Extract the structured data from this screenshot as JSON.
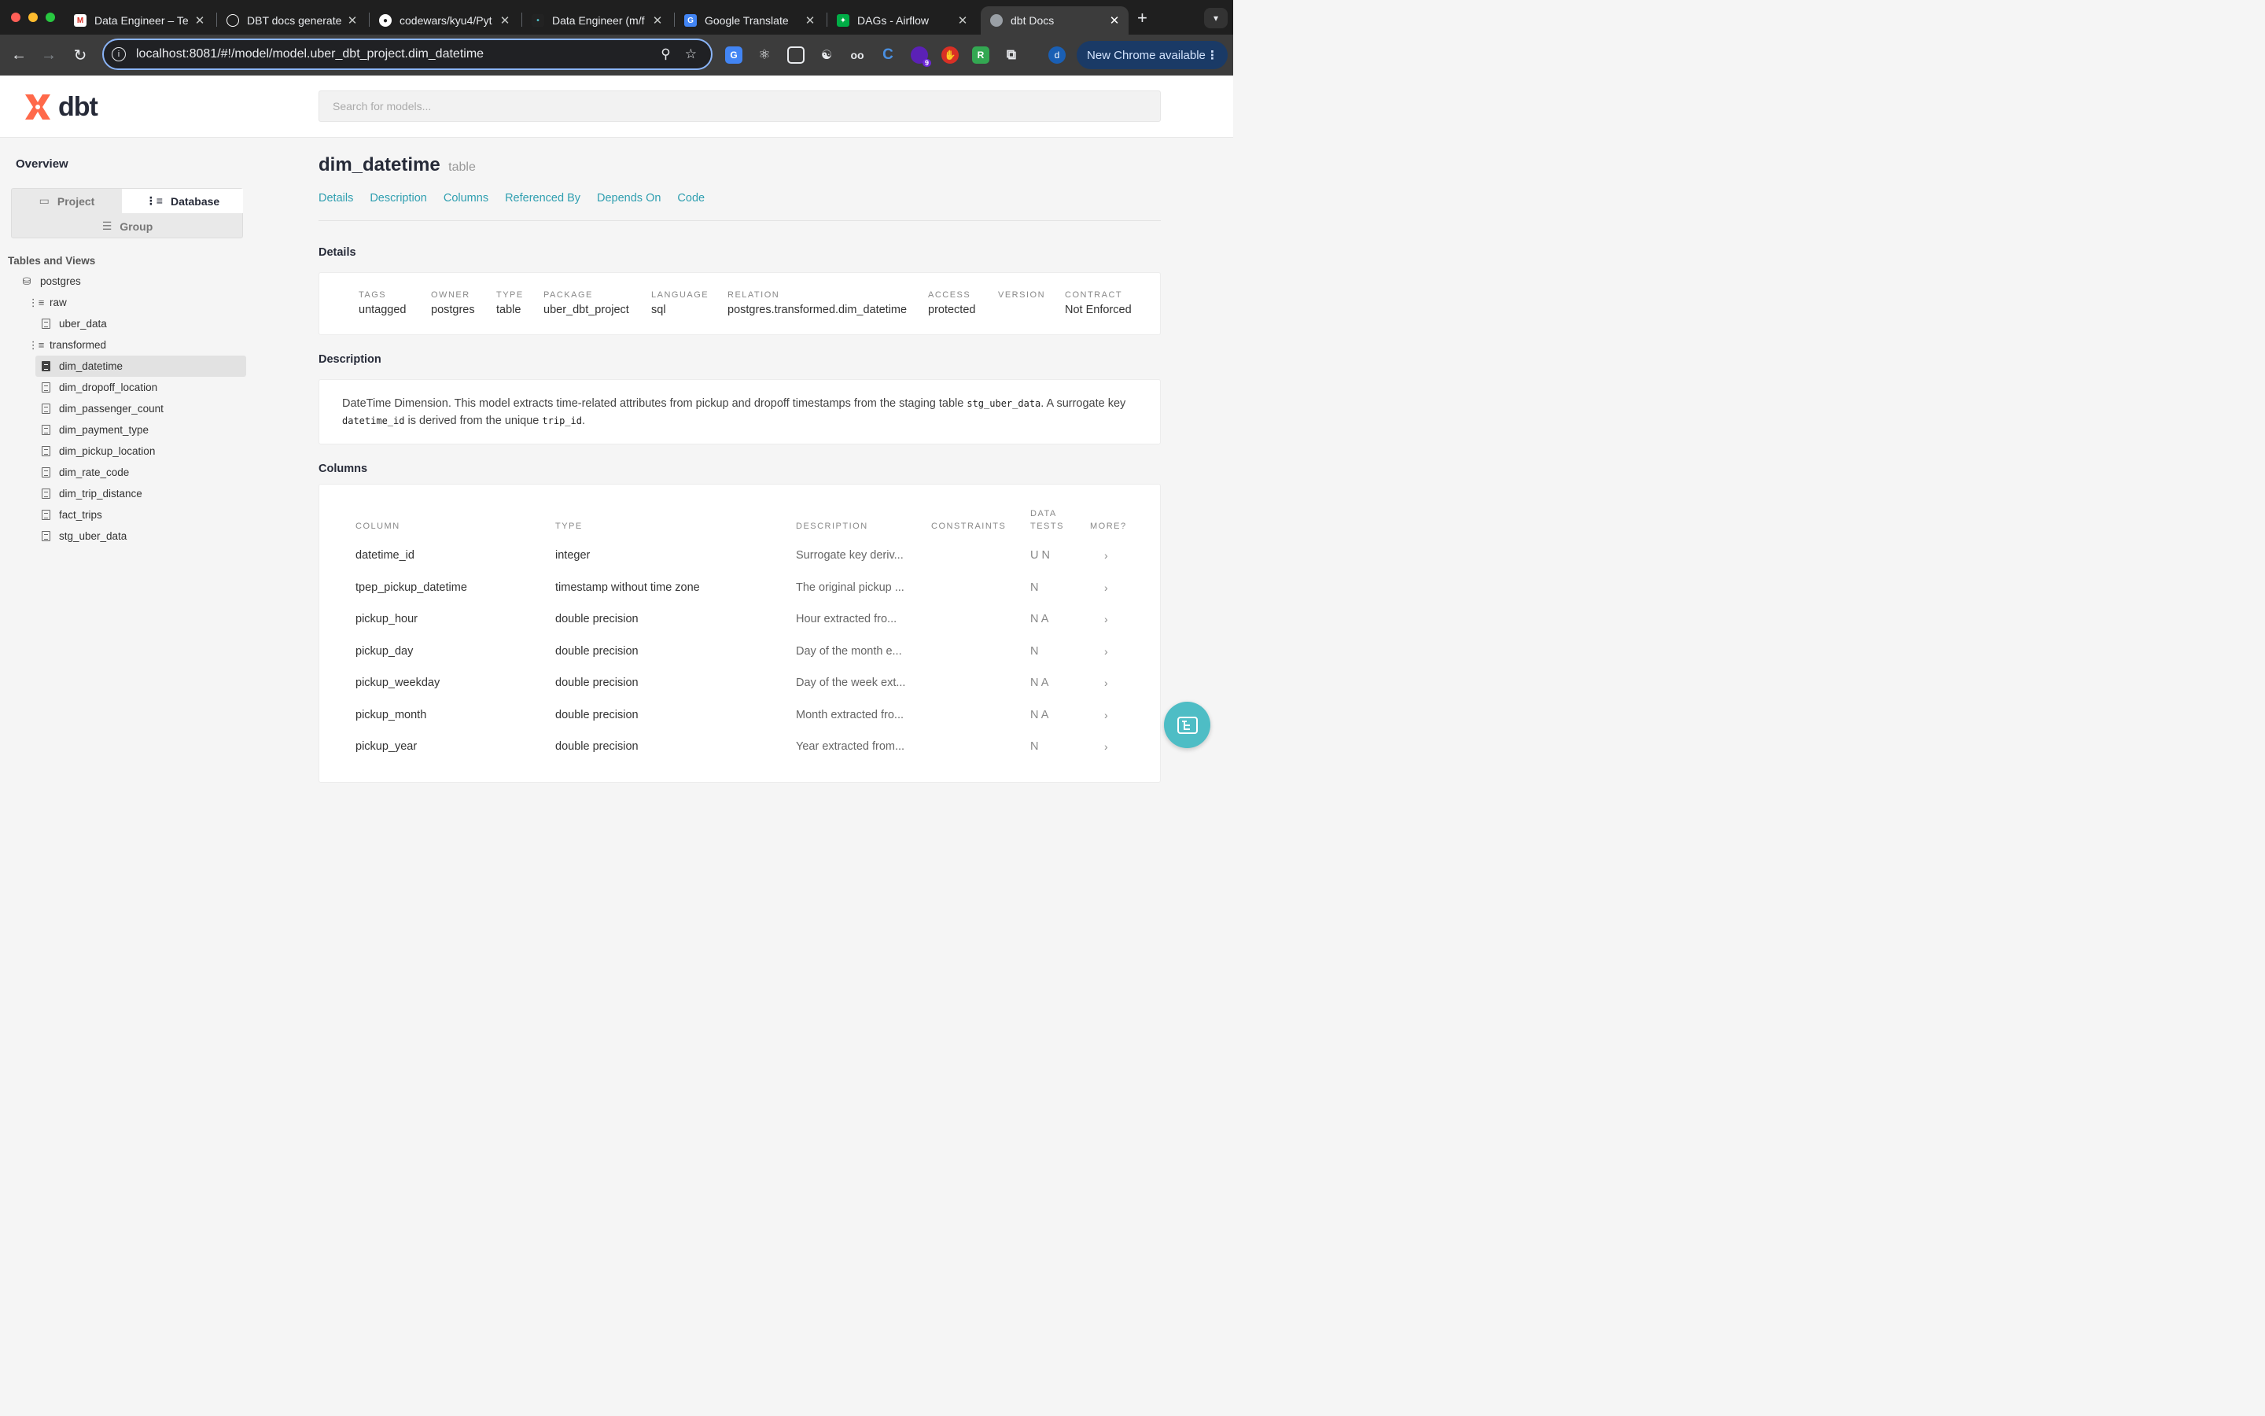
{
  "browser": {
    "tabs": [
      {
        "title": "Data Engineer – Te",
        "icon": "gmail-icon",
        "color": "#d93025"
      },
      {
        "title": "DBT docs generate",
        "icon": "openai-icon",
        "color": "#ffffff"
      },
      {
        "title": "codewars/kyu4/Pyt",
        "icon": "github-icon",
        "color": "#ffffff"
      },
      {
        "title": "Data Engineer (m/f",
        "icon": "site-icon",
        "color": "#4ebdc5"
      },
      {
        "title": "Google Translate",
        "icon": "translate-icon",
        "color": "#4285f4"
      },
      {
        "title": "DAGs - Airflow",
        "icon": "airflow-icon",
        "color": "#00ad46"
      },
      {
        "title": "dbt Docs",
        "icon": "globe-icon",
        "color": "#9aa0a6"
      }
    ],
    "url": "localhost:8081/#!/model/model.uber_dbt_project.dim_datetime",
    "update_label": "New Chrome available",
    "profile_initial": "d",
    "ext_badge": "9"
  },
  "app": {
    "logo_text": "dbt",
    "search_placeholder": "Search for models..."
  },
  "sidebar": {
    "overview": "Overview",
    "switch_project": "Project",
    "switch_database": "Database",
    "switch_group": "Group",
    "tables_title": "Tables and Views",
    "db": "postgres",
    "schema_raw": "raw",
    "raw_items": [
      "uber_data"
    ],
    "schema_transformed": "transformed",
    "transformed_items": [
      "dim_datetime",
      "dim_dropoff_location",
      "dim_passenger_count",
      "dim_payment_type",
      "dim_pickup_location",
      "dim_rate_code",
      "dim_trip_distance",
      "fact_trips",
      "stg_uber_data"
    ]
  },
  "model": {
    "name": "dim_datetime",
    "kind": "table",
    "tabs": [
      "Details",
      "Description",
      "Columns",
      "Referenced By",
      "Depends On",
      "Code"
    ],
    "details_title": "Details",
    "details": [
      {
        "label": "TAGS",
        "value": "untagged"
      },
      {
        "label": "OWNER",
        "value": "postgres"
      },
      {
        "label": "TYPE",
        "value": "table"
      },
      {
        "label": "PACKAGE",
        "value": "uber_dbt_project"
      },
      {
        "label": "LANGUAGE",
        "value": "sql"
      },
      {
        "label": "RELATION",
        "value": "postgres.transformed.dim_datetime"
      },
      {
        "label": "ACCESS",
        "value": "protected"
      },
      {
        "label": "VERSION",
        "value": ""
      },
      {
        "label": "CONTRACT",
        "value": "Not Enforced"
      }
    ],
    "description_title": "Description",
    "description": {
      "p1": "DateTime Dimension. This model extracts time-related attributes from pickup and dropoff timestamps from the staging table ",
      "c1": "stg_uber_data",
      "p2": ". A surrogate key ",
      "c2": "datetime_id",
      "p3": " is derived from the unique ",
      "c3": "trip_id",
      "p4": "."
    },
    "columns_title": "Columns",
    "column_headers": {
      "column": "COLUMN",
      "type": "TYPE",
      "description": "DESCRIPTION",
      "constraints": "CONSTRAINTS",
      "tests_1": "DATA",
      "tests_2": "TESTS",
      "more": "MORE?"
    },
    "columns": [
      {
        "name": "datetime_id",
        "type": "integer",
        "desc": "Surrogate key deriv...",
        "tests": "U N"
      },
      {
        "name": "tpep_pickup_datetime",
        "type": "timestamp without time zone",
        "desc": "The original pickup ...",
        "tests": "N"
      },
      {
        "name": "pickup_hour",
        "type": "double precision",
        "desc": "Hour extracted fro...",
        "tests": "N A"
      },
      {
        "name": "pickup_day",
        "type": "double precision",
        "desc": "Day of the month e...",
        "tests": "N"
      },
      {
        "name": "pickup_weekday",
        "type": "double precision",
        "desc": "Day of the week ext...",
        "tests": "N A"
      },
      {
        "name": "pickup_month",
        "type": "double precision",
        "desc": "Month extracted fro...",
        "tests": "N A"
      },
      {
        "name": "pickup_year",
        "type": "double precision",
        "desc": "Year extracted from...",
        "tests": "N"
      }
    ]
  }
}
